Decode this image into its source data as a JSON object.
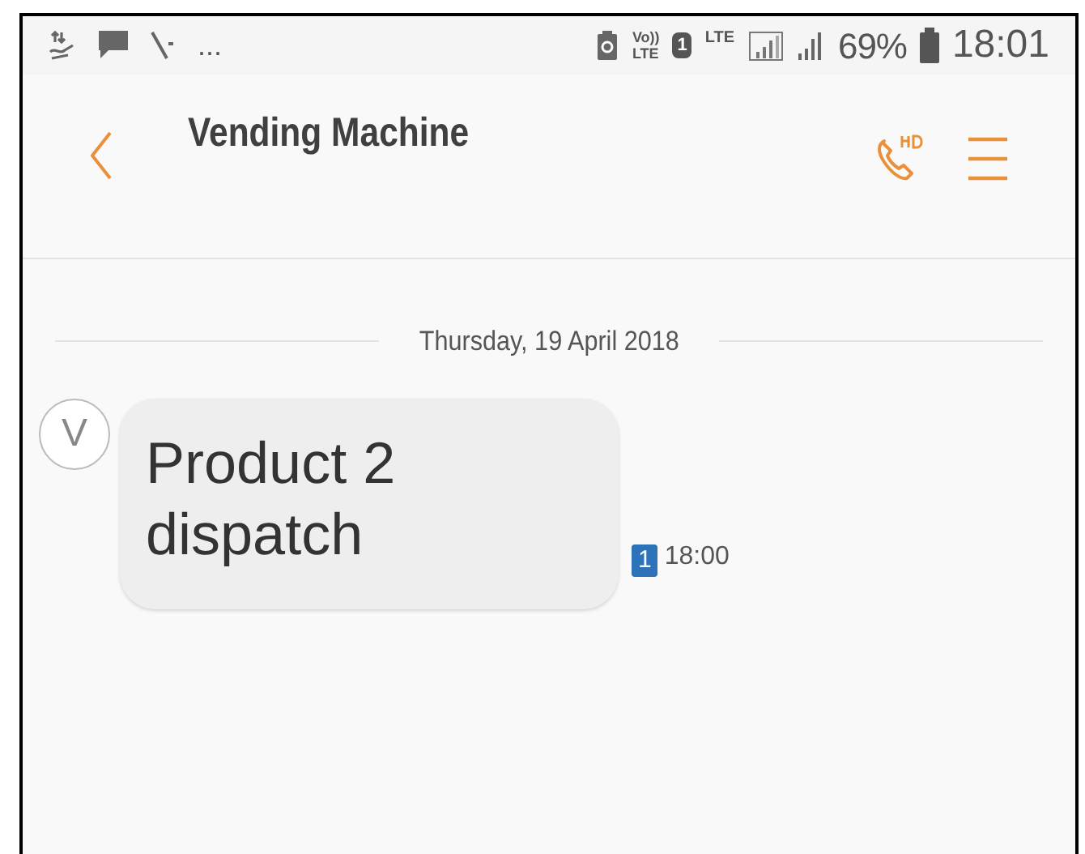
{
  "status_bar": {
    "more": "...",
    "volte": [
      "Vo))",
      "LTE"
    ],
    "sim": "1",
    "network": "LTE",
    "battery": "69%",
    "time": "18:01"
  },
  "header": {
    "title": "Vending Machine"
  },
  "date_divider": "Thursday, 19 April 2018",
  "messages": [
    {
      "avatar": "V",
      "text": "Product 2 dispatch",
      "sim": "1",
      "time": "18:00"
    }
  ]
}
